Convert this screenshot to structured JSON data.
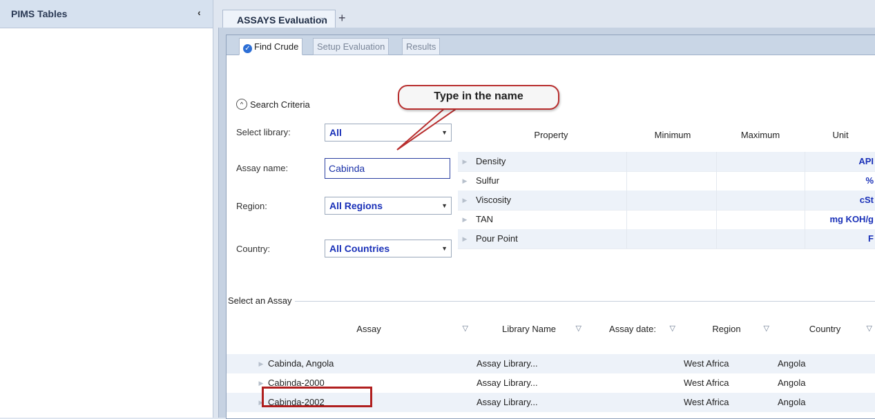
{
  "left_panel": {
    "title": "PIMS Tables",
    "collapse_glyph": "‹"
  },
  "doc_tab": {
    "label": "ASSAYS Evaluation",
    "close_glyph": "×",
    "add_glyph": "+"
  },
  "subtabs": [
    {
      "label": "Find Crude",
      "active": true,
      "icon": "check-circle-icon"
    },
    {
      "label": "Setup Evaluation",
      "active": false
    },
    {
      "label": "Results",
      "active": false
    }
  ],
  "search": {
    "section_label": "Search Criteria",
    "library_label": "Select library:",
    "library_value": "All",
    "assay_name_label": "Assay name:",
    "assay_name_value": "Cabinda",
    "region_label": "Region:",
    "region_value": "All Regions",
    "country_label": "Country:",
    "country_value": "All Countries"
  },
  "property_grid": {
    "headers": [
      "Property",
      "Minimum",
      "Maximum",
      "Unit"
    ],
    "rows": [
      {
        "property": "Density",
        "unit": "API"
      },
      {
        "property": "Sulfur",
        "unit": "%"
      },
      {
        "property": "Viscosity",
        "unit": "cSt"
      },
      {
        "property": "TAN",
        "unit": "mg KOH/g"
      },
      {
        "property": "Pour Point",
        "unit": "F"
      }
    ]
  },
  "assay_grid": {
    "group_label": "Select an Assay",
    "headers": [
      "Assay",
      "Library Name",
      "Assay date:",
      "Region",
      "Country"
    ],
    "rows": [
      {
        "assay": "Cabinda, Angola",
        "library": "Assay Library...",
        "date": "",
        "region": "West Africa",
        "country": "Angola"
      },
      {
        "assay": "Cabinda-2000",
        "library": "Assay Library...",
        "date": "",
        "region": "West Africa",
        "country": "Angola"
      },
      {
        "assay": "Cabinda-2002",
        "library": "Assay Library...",
        "date": "",
        "region": "West Africa",
        "country": "Angola"
      }
    ]
  },
  "annotation": {
    "callout_text": "Type in the name",
    "color": "#b82d2d"
  },
  "colors": {
    "accent_value": "#1930b8",
    "panel_header": "#d6e1ef",
    "row_shade": "#edf2f9"
  }
}
